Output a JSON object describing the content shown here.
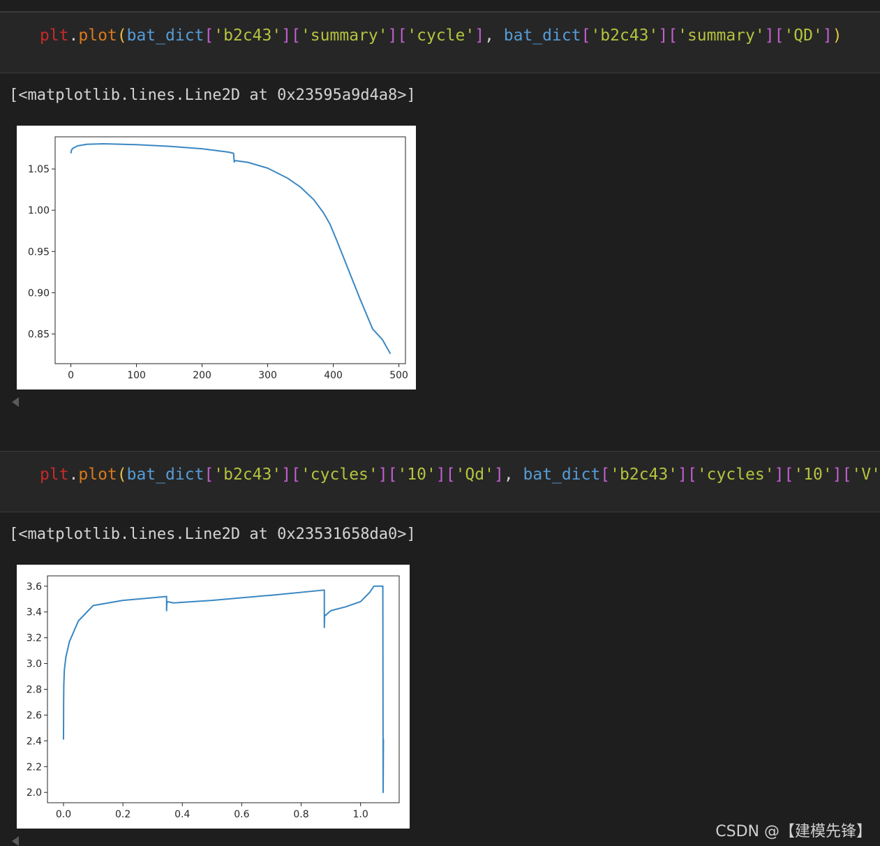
{
  "cells": [
    {
      "code_tokens": [
        "plt",
        ".",
        "plot",
        "(",
        "bat_dict",
        "[",
        "'b2c43'",
        "]",
        "[",
        "'summary'",
        "]",
        "[",
        "'cycle'",
        "]",
        ", ",
        "bat_dict",
        "[",
        "'b2c43'",
        "]",
        "[",
        "'summary'",
        "]",
        "[",
        "'QD'",
        "]",
        ")"
      ],
      "output_text": "[<matplotlib.lines.Line2D at 0x23595a9d4a8>]"
    },
    {
      "code_tokens": [
        "plt",
        ".",
        "plot",
        "(",
        "bat_dict",
        "[",
        "'b2c43'",
        "]",
        "[",
        "'cycles'",
        "]",
        "[",
        "'10'",
        "]",
        "[",
        "'Qd'",
        "]",
        ", ",
        "bat_dict",
        "[",
        "'b2c43'",
        "]",
        "[",
        "'cycles'",
        "]",
        "[",
        "'10'",
        "]",
        "[",
        "'V'",
        "]",
        ")"
      ],
      "output_text": "[<matplotlib.lines.Line2D at 0x23531658da0>]"
    }
  ],
  "chart_data": [
    {
      "type": "line",
      "title": "",
      "xlabel": "",
      "ylabel": "",
      "xlim": [
        -24,
        510
      ],
      "ylim": [
        0.814,
        1.089
      ],
      "xticks": [
        "0",
        "100",
        "200",
        "300",
        "400",
        "500"
      ],
      "yticks": [
        "0.85",
        "0.90",
        "0.95",
        "1.00",
        "1.05"
      ],
      "grid": false,
      "series": [
        {
          "color": "#3a87c2",
          "x": [
            0,
            1,
            3,
            10,
            25,
            50,
            100,
            150,
            200,
            240,
            248,
            249,
            250,
            252,
            270,
            300,
            330,
            350,
            370,
            385,
            395,
            405,
            420,
            440,
            460,
            475,
            487
          ],
          "y": [
            1.069,
            1.073,
            1.075,
            1.078,
            1.08,
            1.0805,
            1.0795,
            1.0775,
            1.0745,
            1.0705,
            1.069,
            1.0585,
            1.06,
            1.06,
            1.058,
            1.051,
            1.039,
            1.028,
            1.013,
            0.997,
            0.983,
            0.964,
            0.934,
            0.894,
            0.856,
            0.843,
            0.826
          ]
        }
      ]
    },
    {
      "type": "line",
      "title": "",
      "xlabel": "",
      "ylabel": "",
      "xlim": [
        -0.054,
        1.13
      ],
      "ylim": [
        1.92,
        3.68
      ],
      "xticks": [
        "0.0",
        "0.2",
        "0.4",
        "0.6",
        "0.8",
        "1.0"
      ],
      "yticks": [
        "2.0",
        "2.2",
        "2.4",
        "2.6",
        "2.8",
        "3.0",
        "3.2",
        "3.4",
        "3.6"
      ],
      "grid": false,
      "series": [
        {
          "color": "#3a87c2",
          "x": [
            0,
            0.0005,
            0.001,
            0.003,
            0.008,
            0.02,
            0.05,
            0.1,
            0.2,
            0.3,
            0.347,
            0.347,
            0.348,
            0.349,
            0.35,
            0.37,
            0.5,
            0.7,
            0.878,
            0.878,
            0.879,
            0.88,
            0.9,
            0.95,
            1.0,
            1.03,
            1.045,
            1.075,
            1.076,
            1.077,
            1.076
          ],
          "y": [
            2.41,
            2.7,
            2.83,
            2.95,
            3.05,
            3.17,
            3.33,
            3.45,
            3.49,
            3.51,
            3.52,
            3.41,
            3.47,
            3.47,
            3.48,
            3.47,
            3.49,
            3.53,
            3.57,
            3.28,
            3.38,
            3.37,
            3.41,
            3.44,
            3.48,
            3.55,
            3.6,
            3.6,
            2.0,
            2.41,
            2.0
          ]
        }
      ]
    }
  ],
  "watermark": "CSDN @【建模先锋】"
}
